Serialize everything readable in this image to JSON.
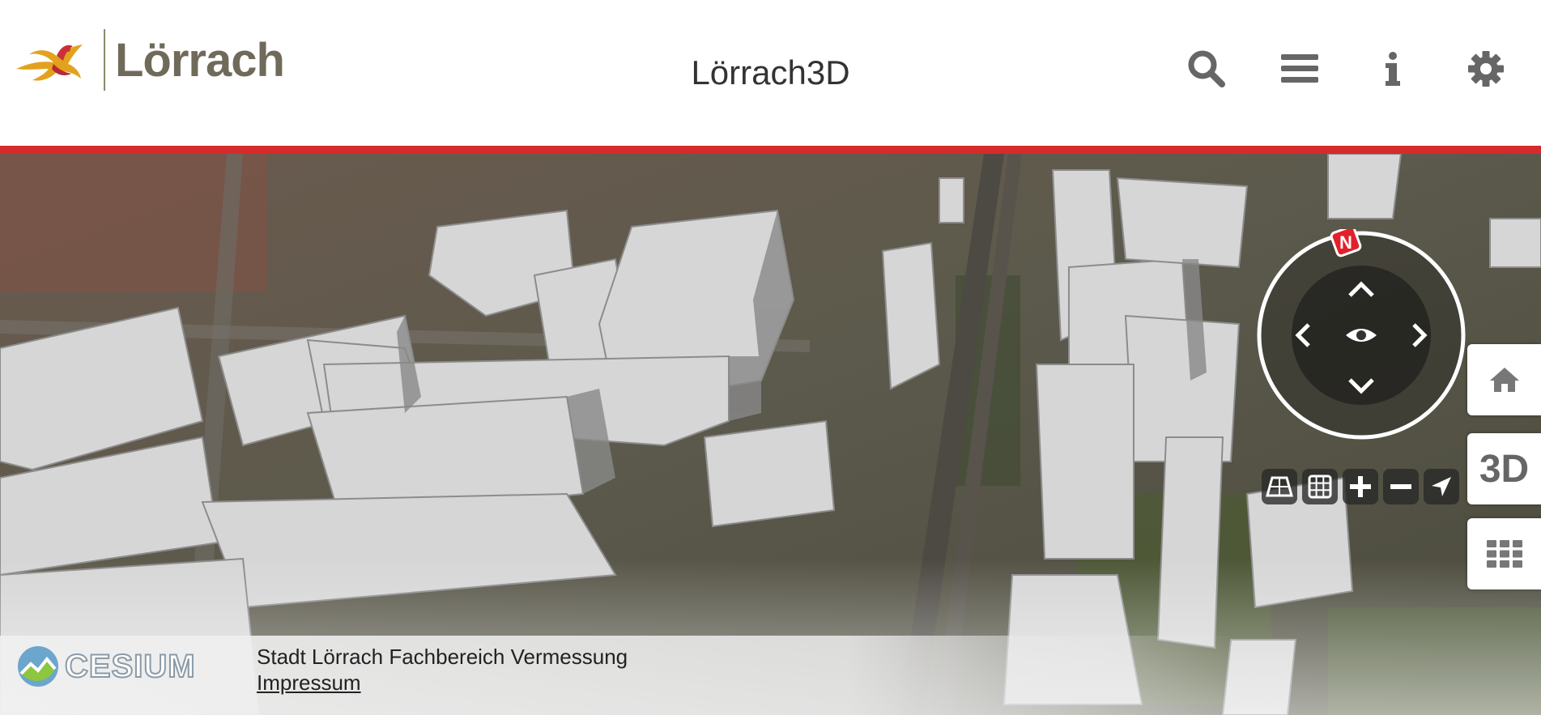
{
  "header": {
    "logo_text": "Lörrach",
    "title": "Lörrach3D",
    "accent_color": "#d52b2b",
    "buttons": [
      {
        "name": "search",
        "icon": "search-icon"
      },
      {
        "name": "layers",
        "icon": "menu-icon"
      },
      {
        "name": "info",
        "icon": "info-icon"
      },
      {
        "name": "settings",
        "icon": "gear-icon"
      }
    ]
  },
  "navigation": {
    "compass_label": "N",
    "tools": [
      "tilt-view-icon",
      "grid-view-icon",
      "zoom-in-icon",
      "zoom-out-icon",
      "locate-icon"
    ]
  },
  "side_buttons": {
    "home_icon": "home-icon",
    "mode_label": "3D",
    "apps_icon": "apps-grid-icon"
  },
  "footer": {
    "engine_logo": "CESIUM",
    "credit_text": "Stadt Lörrach Fachbereich Vermessung",
    "imprint_link": "Impressum"
  }
}
